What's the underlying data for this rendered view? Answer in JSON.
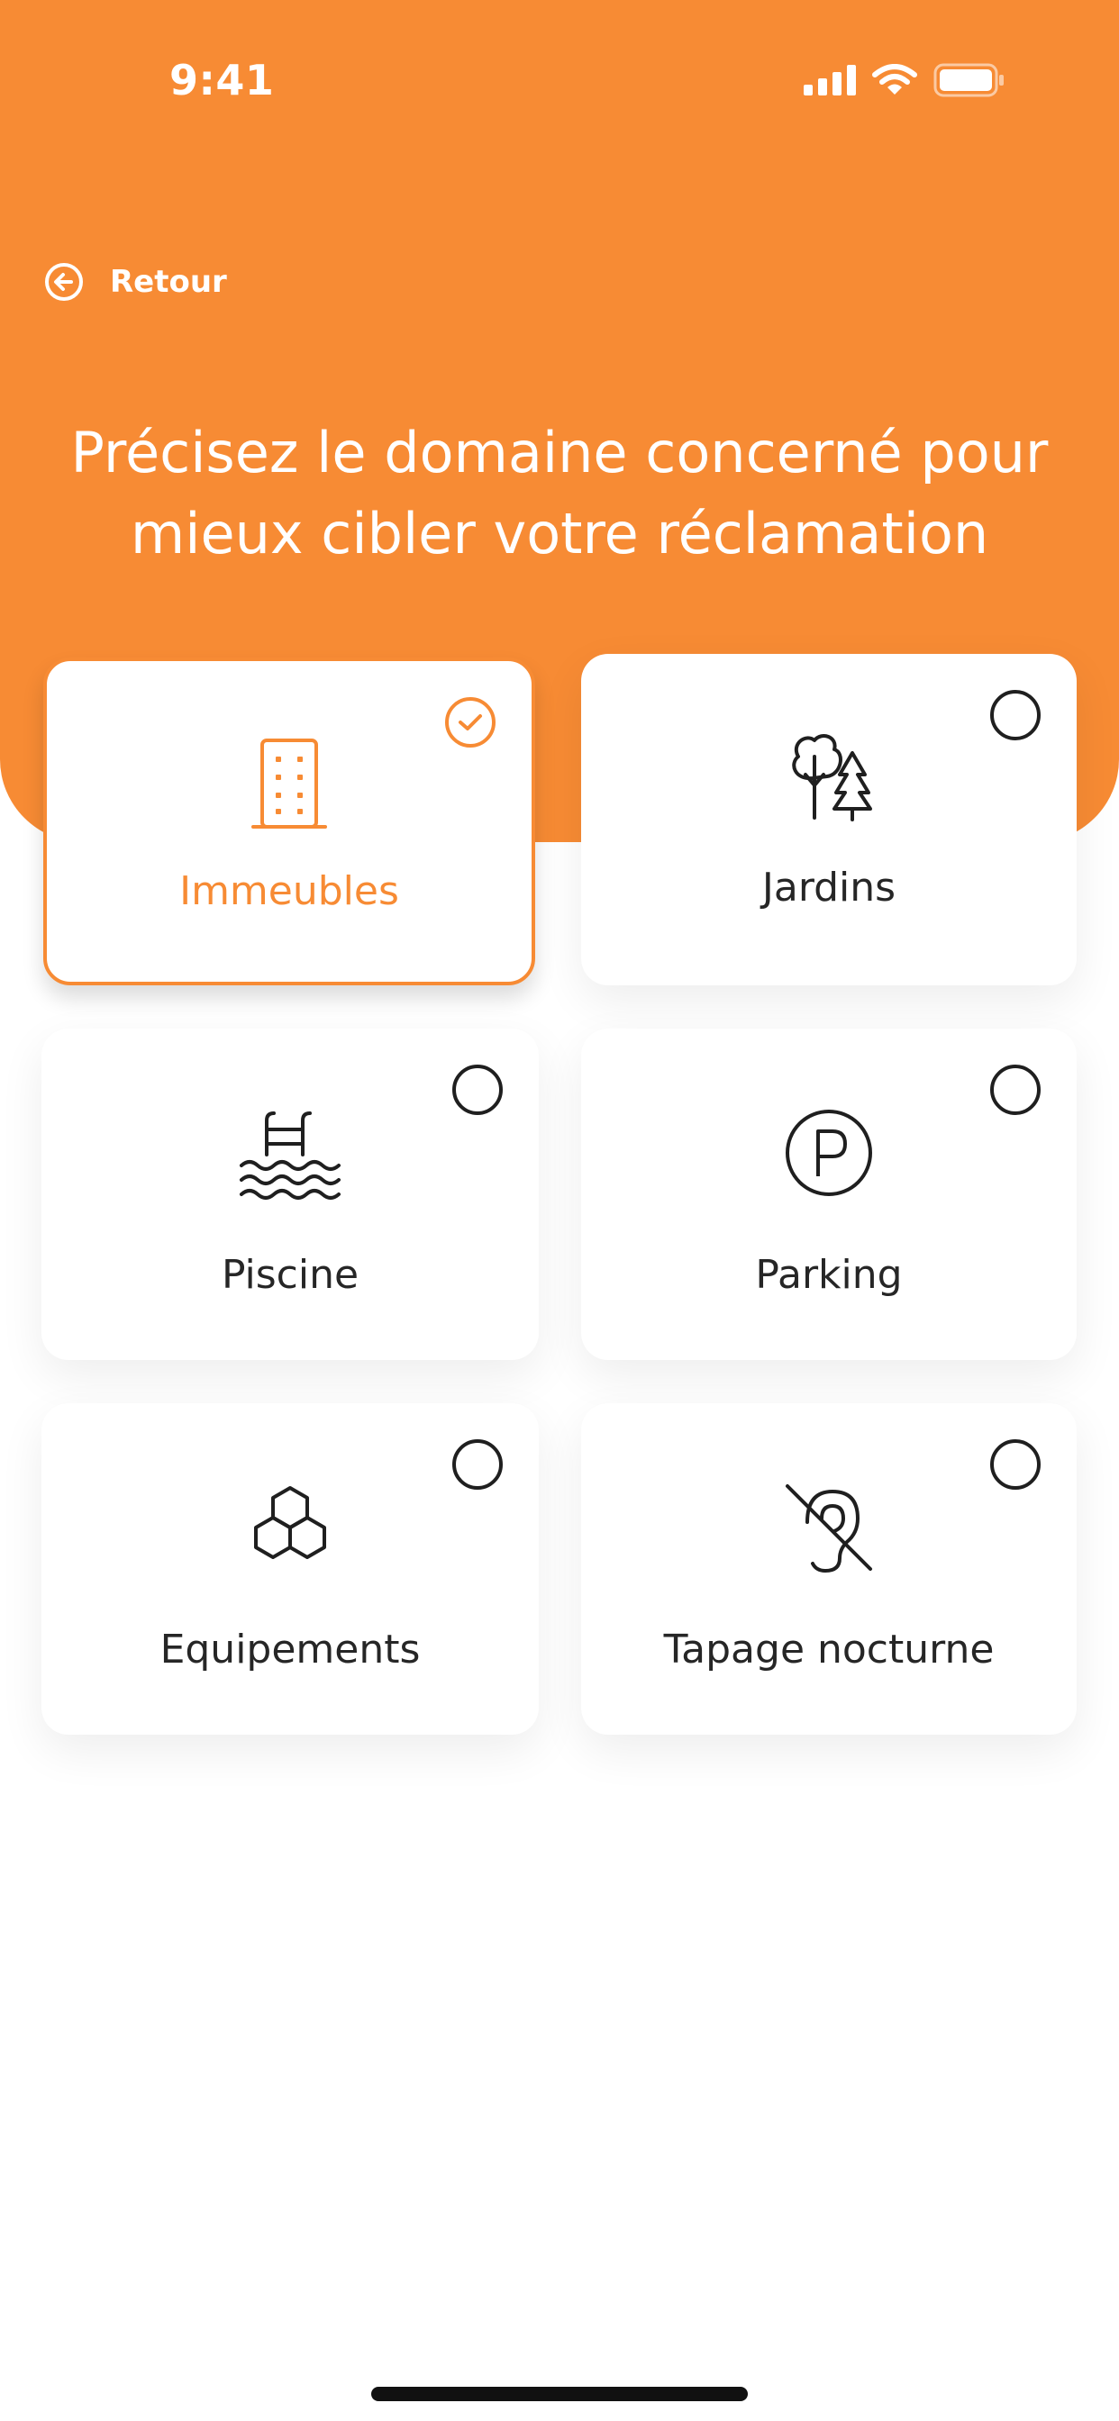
{
  "status_bar": {
    "time": "9:41",
    "icons": [
      "cellular-signal-icon",
      "wifi-icon",
      "battery-icon"
    ]
  },
  "header": {
    "back_label": "Retour",
    "title": "Précisez le domaine concerné pour mieux cibler votre réclamation"
  },
  "theme": {
    "accent": "#F78B34",
    "text": "#262626",
    "background": "#FFFFFF"
  },
  "categories": [
    {
      "label": "Immeubles",
      "icon": "building-icon",
      "selected": true
    },
    {
      "label": "Jardins",
      "icon": "trees-icon",
      "selected": false
    },
    {
      "label": "Piscine",
      "icon": "pool-ladder-icon",
      "selected": false
    },
    {
      "label": "Parking",
      "icon": "parking-icon",
      "selected": false
    },
    {
      "label": "Equipements",
      "icon": "hexagons-icon",
      "selected": false
    },
    {
      "label": "Tapage nocturne",
      "icon": "hearing-off-icon",
      "selected": false
    }
  ]
}
